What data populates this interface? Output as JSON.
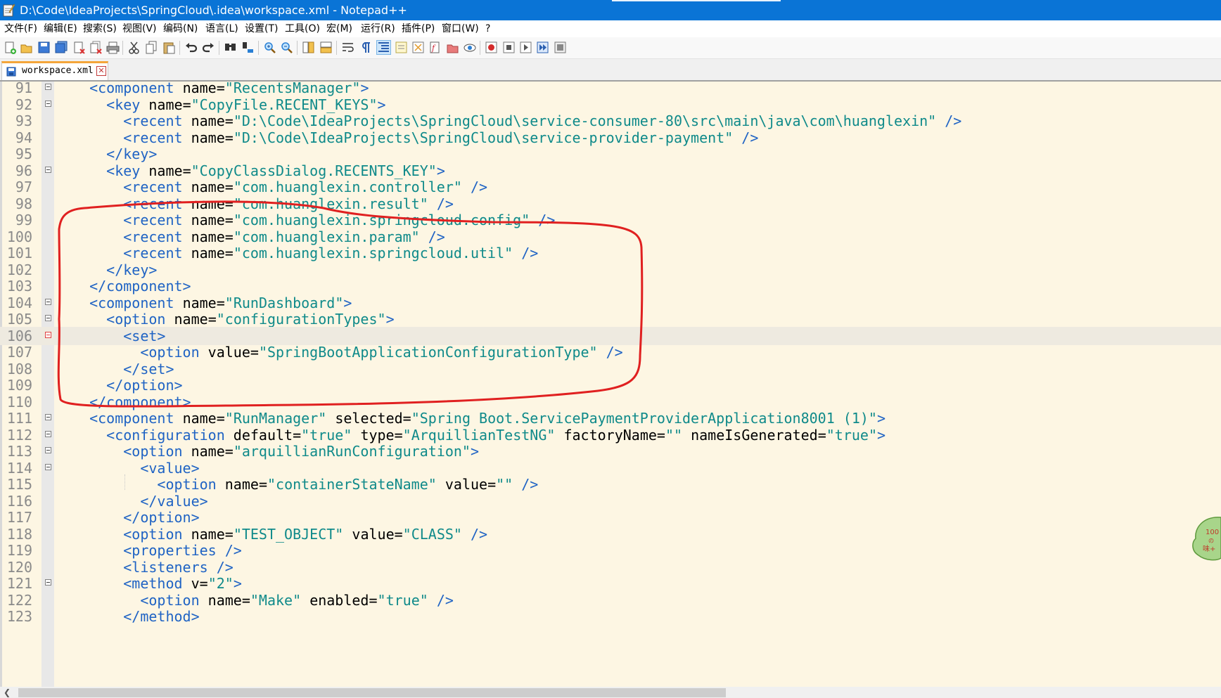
{
  "window": {
    "title": "D:\\Code\\IdeaProjects\\SpringCloud\\.idea\\workspace.xml - Notepad++"
  },
  "menu": [
    "文件(F)",
    "编辑(E)",
    "搜索(S)",
    "视图(V)",
    "编码(N)",
    "语言(L)",
    "设置(T)",
    "工具(O)",
    "宏(M)",
    "运行(R)",
    "插件(P)",
    "窗口(W)",
    "?"
  ],
  "toolbar": {
    "buttons": [
      "new-file",
      "open-file",
      "save",
      "save-all",
      "close",
      "close-all",
      "print",
      "cut",
      "copy",
      "paste",
      "undo",
      "redo",
      "find",
      "replace",
      "zoom-in",
      "zoom-out",
      "sync-vertical",
      "sync-horizontal",
      "word-wrap",
      "show-all-chars",
      "indent-guide",
      "udl",
      "doc-map",
      "function-list",
      "folder-workspace",
      "monitor",
      "record-macro",
      "stop-record",
      "play-macro",
      "run-macro-multiple",
      "save-macro"
    ]
  },
  "tab": {
    "filename": "workspace.xml"
  },
  "editor": {
    "current_line": 106,
    "lines": [
      {
        "n": "91",
        "t": "  <component name=\"RecentsManager\">"
      },
      {
        "n": "92",
        "t": "    <key name=\"CopyFile.RECENT_KEYS\">"
      },
      {
        "n": "93",
        "t": "      <recent name=\"D:\\Code\\IdeaProjects\\SpringCloud\\service-consumer-80\\src\\main\\java\\com\\huanglexin\" />"
      },
      {
        "n": "94",
        "t": "      <recent name=\"D:\\Code\\IdeaProjects\\SpringCloud\\service-provider-payment\" />"
      },
      {
        "n": "95",
        "t": "    </key>"
      },
      {
        "n": "96",
        "t": "    <key name=\"CopyClassDialog.RECENTS_KEY\">"
      },
      {
        "n": "97",
        "t": "      <recent name=\"com.huanglexin.controller\" />"
      },
      {
        "n": "98",
        "t": "      <recent name=\"com.huanglexin.result\" />"
      },
      {
        "n": "99",
        "t": "      <recent name=\"com.huanglexin.springcloud.config\" />"
      },
      {
        "n": "100",
        "t": "      <recent name=\"com.huanglexin.param\" />"
      },
      {
        "n": "101",
        "t": "      <recent name=\"com.huanglexin.springcloud.util\" />"
      },
      {
        "n": "102",
        "t": "    </key>"
      },
      {
        "n": "103",
        "t": "  </component>"
      },
      {
        "n": "104",
        "t": "  <component name=\"RunDashboard\">"
      },
      {
        "n": "105",
        "t": "    <option name=\"configurationTypes\">"
      },
      {
        "n": "106",
        "t": "      <set>"
      },
      {
        "n": "107",
        "t": "        <option value=\"SpringBootApplicationConfigurationType\" />"
      },
      {
        "n": "108",
        "t": "      </set>"
      },
      {
        "n": "109",
        "t": "    </option>"
      },
      {
        "n": "110",
        "t": "  </component>"
      },
      {
        "n": "111",
        "t": "  <component name=\"RunManager\" selected=\"Spring Boot.ServicePaymentProviderApplication8001 (1)\">"
      },
      {
        "n": "112",
        "t": "    <configuration default=\"true\" type=\"ArquillianTestNG\" factoryName=\"\" nameIsGenerated=\"true\">"
      },
      {
        "n": "113",
        "t": "      <option name=\"arquillianRunConfiguration\">"
      },
      {
        "n": "114",
        "t": "        <value>"
      },
      {
        "n": "115",
        "t": "          <option name=\"containerStateName\" value=\"\" />"
      },
      {
        "n": "116",
        "t": "        </value>"
      },
      {
        "n": "117",
        "t": "      </option>"
      },
      {
        "n": "118",
        "t": "      <option name=\"TEST_OBJECT\" value=\"CLASS\" />"
      },
      {
        "n": "119",
        "t": "      <properties />"
      },
      {
        "n": "120",
        "t": "      <listeners />"
      },
      {
        "n": "121",
        "t": "      <method v=\"2\">"
      },
      {
        "n": "122",
        "t": "        <option name=\"Make\" enabled=\"true\" />"
      },
      {
        "n": "123",
        "t": "      </method>"
      }
    ],
    "fold_lines": [
      "91",
      "92",
      "96",
      "104",
      "105",
      "106",
      "111",
      "112",
      "113",
      "114",
      "121"
    ],
    "red_fold_lines": [
      "106"
    ]
  },
  "colors": {
    "titlebar": "#0a74d6",
    "editor_bg": "#fdf6e3",
    "tag": "#1f63c4",
    "value": "#0f8a8a",
    "annotation": "#e02020"
  }
}
